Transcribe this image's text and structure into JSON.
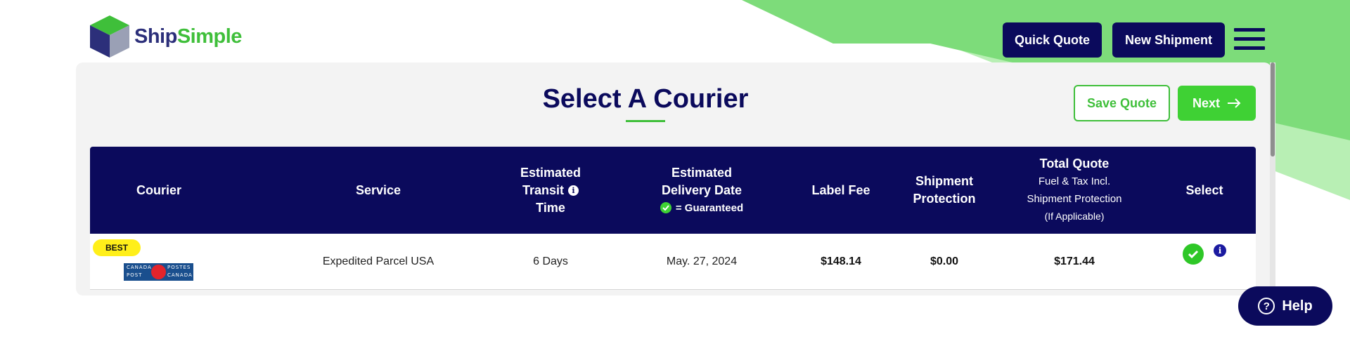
{
  "brand": {
    "name_part1": "Ship",
    "name_part2": "Simple"
  },
  "header": {
    "quick_quote": "Quick Quote",
    "new_shipment": "New Shipment"
  },
  "page": {
    "title": "Select A Courier",
    "save_quote": "Save Quote",
    "next": "Next"
  },
  "table": {
    "headers": {
      "courier": "Courier",
      "service": "Service",
      "transit_1": "Estimated",
      "transit_2": "Transit",
      "transit_3": "Time",
      "delivery_1": "Estimated",
      "delivery_2": "Delivery Date",
      "delivery_guaranteed": "= Guaranteed",
      "label_fee": "Label Fee",
      "protection_1": "Shipment",
      "protection_2": "Protection",
      "total_1": "Total Quote",
      "total_2": "Fuel & Tax Incl.",
      "total_3": "Shipment Protection",
      "total_4": "(If Applicable)",
      "select": "Select"
    },
    "rows": [
      {
        "badge": "BEST",
        "courier_logo_lines": [
          "CANADA",
          "POST",
          "POSTES",
          "CANADA"
        ],
        "service": "Expedited Parcel USA",
        "transit": "6 Days",
        "delivery": "May. 27, 2024",
        "label_fee": "$148.14",
        "protection": "$0.00",
        "total": "$171.44"
      }
    ]
  },
  "help": {
    "label": "Help"
  },
  "colors": {
    "navy": "#0b0a5c",
    "green": "#3fd134",
    "badge_yellow": "#ffef1a"
  }
}
